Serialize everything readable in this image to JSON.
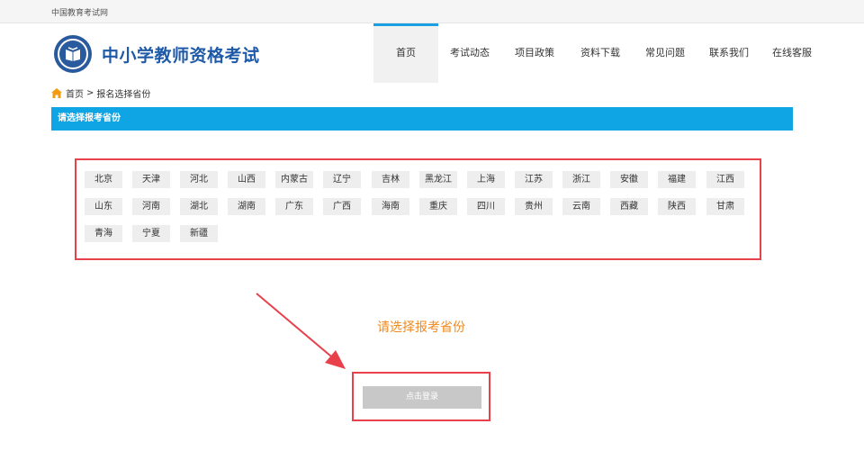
{
  "topbar": {
    "site_name": "中国教育考试网"
  },
  "header": {
    "title": "中小学教师资格考试"
  },
  "nav": [
    "首页",
    "考试动态",
    "项目政策",
    "资料下载",
    "常见问题",
    "联系我们",
    "在线客服"
  ],
  "breadcrumb": {
    "home": "首页",
    "separator": ">",
    "current": "报名选择省份"
  },
  "section": {
    "title": "请选择报考省份"
  },
  "provinces": [
    [
      "北京",
      "天津",
      "河北",
      "山西",
      "内蒙古",
      "辽宁",
      "吉林",
      "黑龙江",
      "上海",
      "江苏",
      "浙江",
      "安徽",
      "福建",
      "江西"
    ],
    [
      "山东",
      "河南",
      "湖北",
      "湖南",
      "广东",
      "广西",
      "海南",
      "重庆",
      "四川",
      "贵州",
      "云南",
      "西藏",
      "陕西",
      "甘肃"
    ],
    [
      "青海",
      "宁夏",
      "新疆"
    ]
  ],
  "prompt": "请选择报考省份",
  "login_button": "点击登录",
  "colors": {
    "accent": "#0fa4e3",
    "highlight": "#e8414b",
    "prompt": "#f08a1e",
    "brand": "#1f5aa8"
  }
}
